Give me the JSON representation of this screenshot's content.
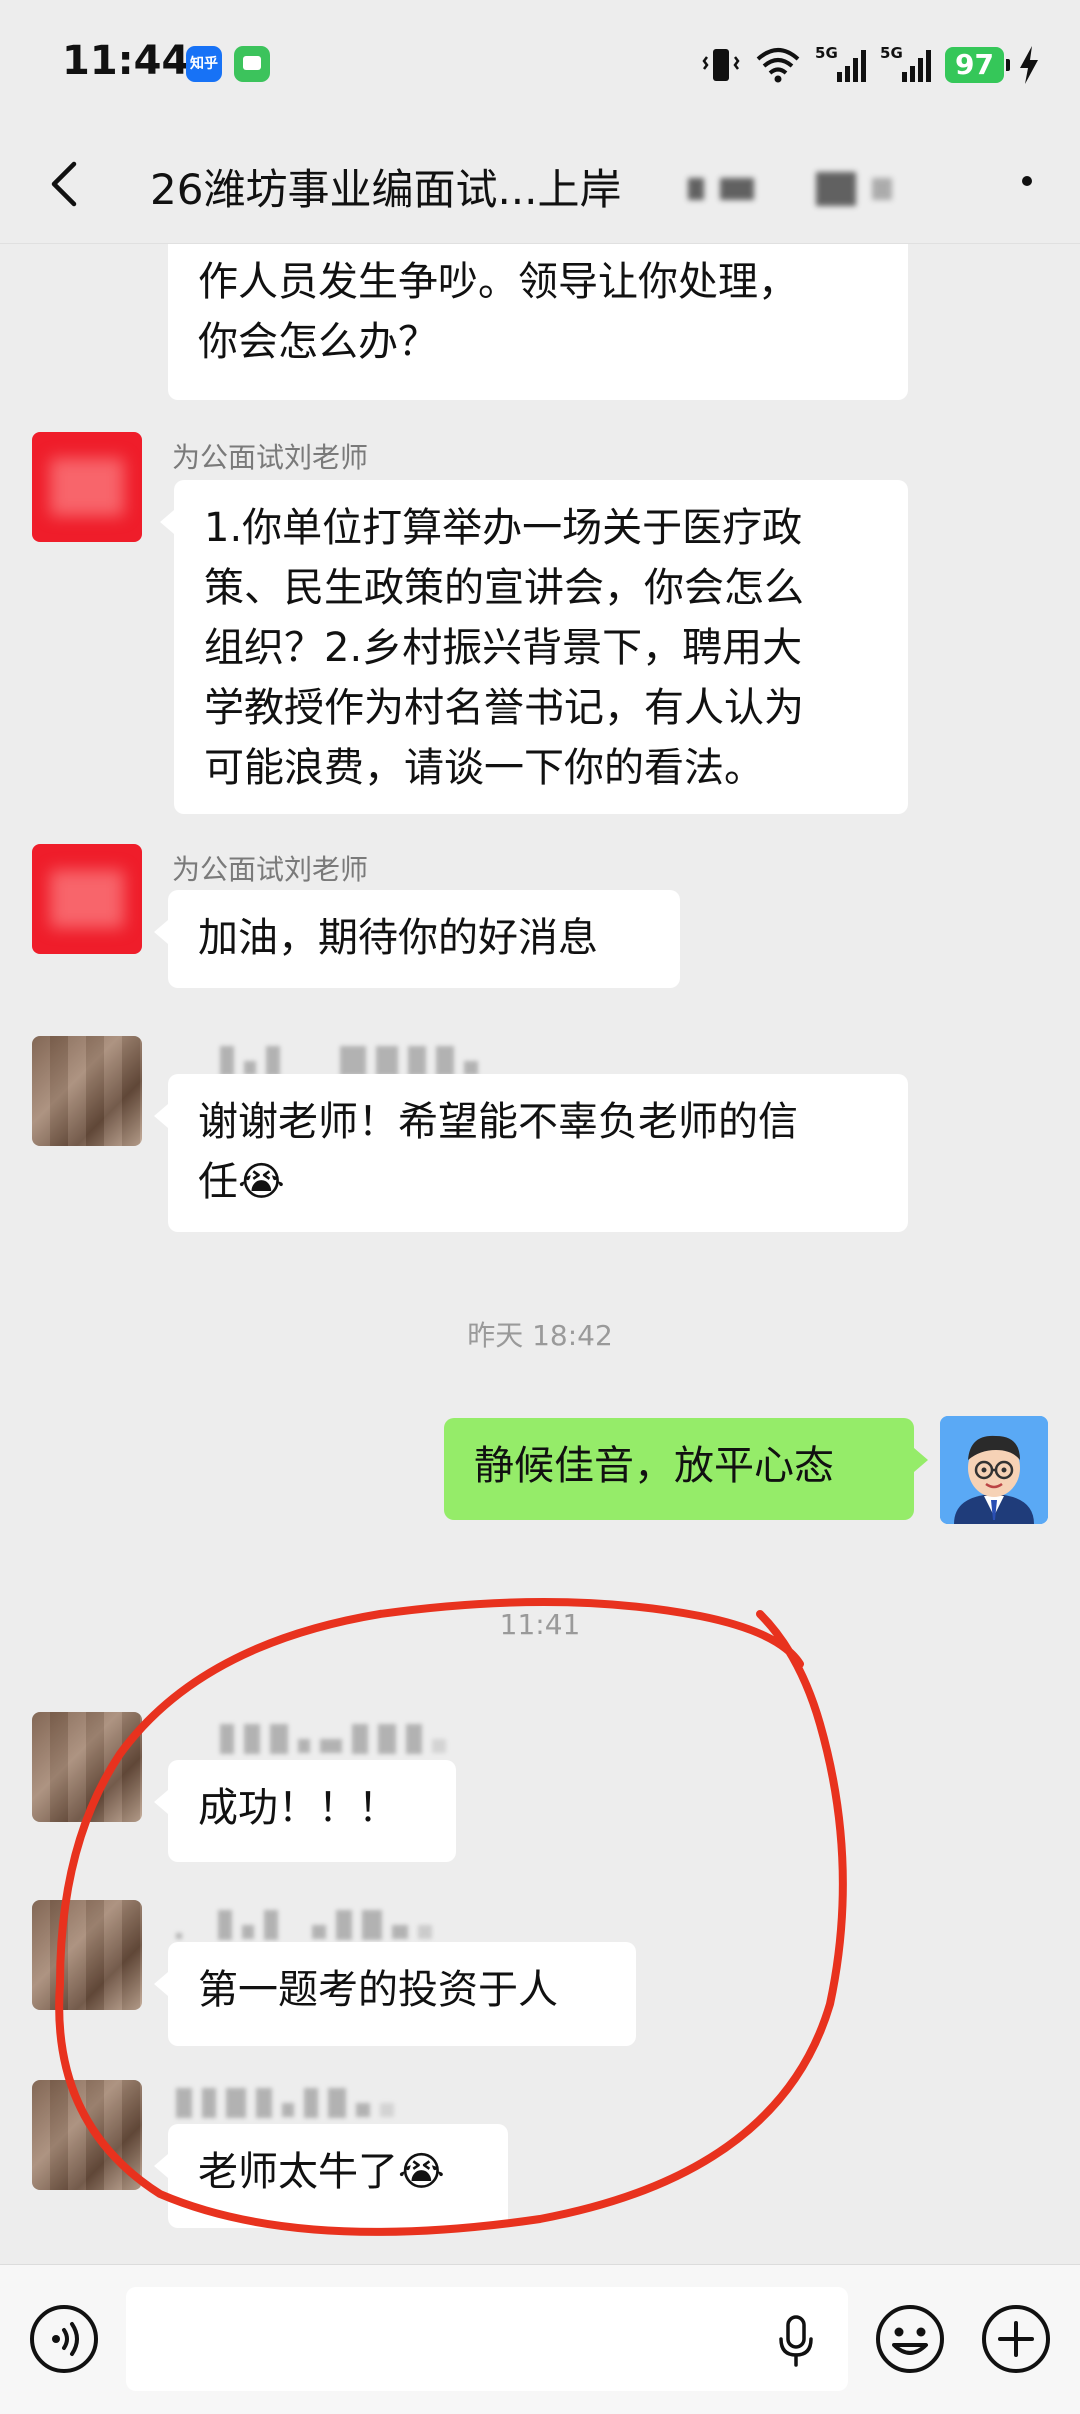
{
  "status_bar": {
    "time": "11:44",
    "app_zhihu": "知乎",
    "net1": "5G",
    "net2": "5G",
    "battery": "97"
  },
  "header": {
    "title": "26潍坊事业编面试...上岸"
  },
  "messages": [
    {
      "id": "m1",
      "text_lines": [
        "作人员发生争吵。领导让你处理，",
        "你会怎么办？"
      ]
    },
    {
      "id": "m2",
      "sender": "为公面试刘老师",
      "text_lines": [
        "1.你单位打算举办一场关于医疗政",
        "策、民生政策的宣讲会，你会怎么",
        "组织？2.乡村振兴背景下，聘用大",
        "学教授作为村名誉书记，有人认为",
        "可能浪费，请谈一下你的看法。"
      ]
    },
    {
      "id": "m3",
      "sender": "为公面试刘老师",
      "text": "加油，期待你的好消息"
    },
    {
      "id": "m4",
      "text_lines": [
        "谢谢老师！希望能不辜负老师的信",
        "任😭"
      ]
    },
    {
      "id": "t1",
      "timestamp": "昨天 18:42"
    },
    {
      "id": "m5",
      "text": "静候佳音，放平心态"
    },
    {
      "id": "t2",
      "timestamp": "11:41"
    },
    {
      "id": "m6",
      "text": "成功！！！"
    },
    {
      "id": "m7",
      "text": "第一题考的投资于人"
    },
    {
      "id": "m8",
      "text": "老师太牛了😭"
    }
  ],
  "colors": {
    "bg": "#ededed",
    "bubble_self": "#95ec69",
    "annotation": "#e8321e",
    "battery": "#35c759"
  },
  "icons": {
    "back": "chevron-left-icon",
    "more": "more-icon",
    "voice": "voice-icon",
    "mic": "mic-icon",
    "emoji": "emoji-icon",
    "plus": "plus-icon"
  }
}
